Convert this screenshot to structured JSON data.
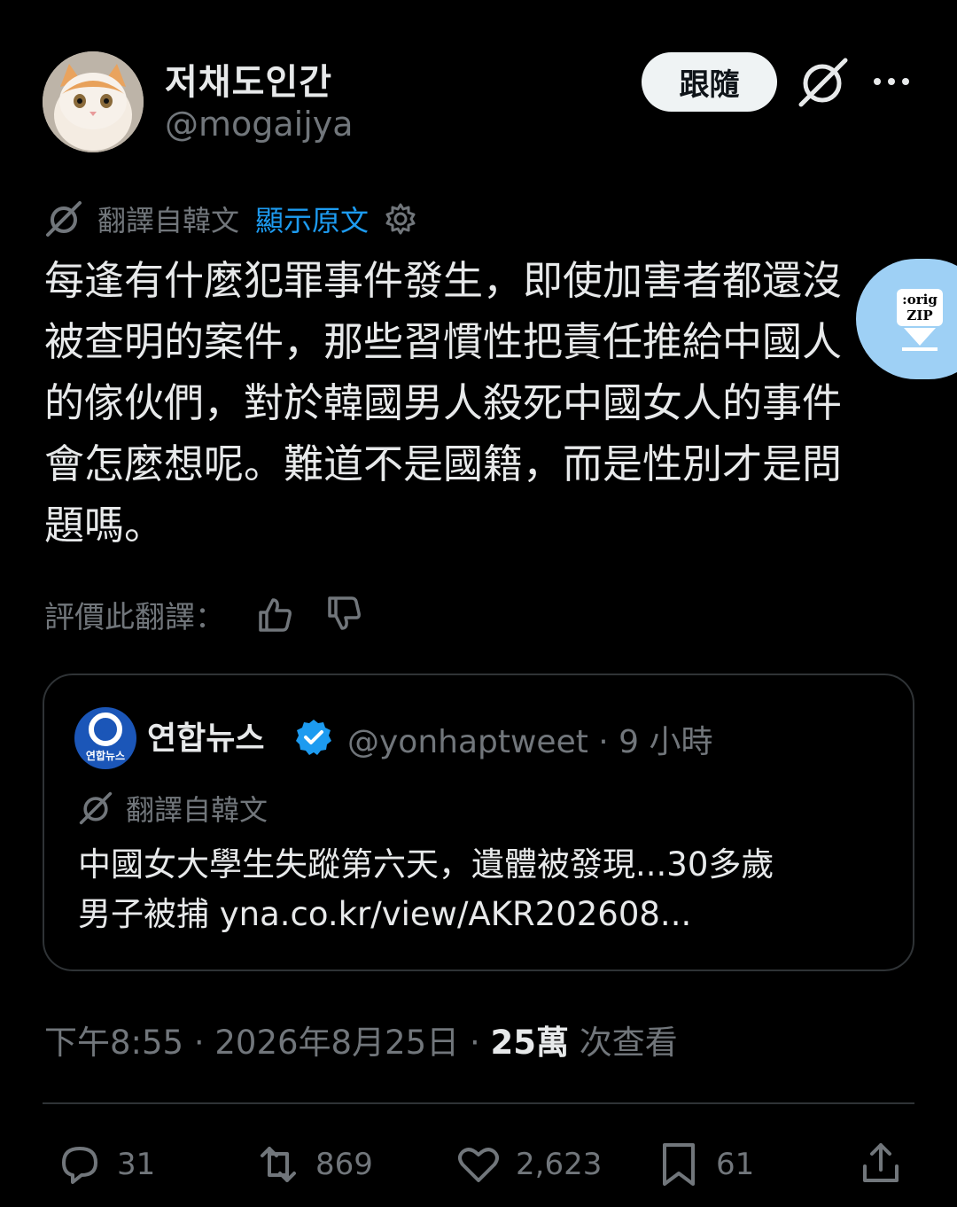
{
  "author": {
    "display_name": "저채도인간",
    "handle": "@mogaijya",
    "avatar": "orange-white-cat-photo"
  },
  "header_actions": {
    "follow_label": "跟隨",
    "grok_icon": "grok-icon",
    "more_icon": "more-icon"
  },
  "translation": {
    "translated_from": "翻譯自韓文",
    "show_original": "顯示原文",
    "settings_icon": "gear-icon"
  },
  "tweet": {
    "text": "每逢有什麼犯罪事件發生，即使加害者都還沒\n被查明的案件，那些習慣性把責任推給中國人\n的傢伙們，對於韓國男人殺死中國女人的事件\n會怎麼想呢。難道不是國籍，而是性別才是問\n題嗎。"
  },
  "overlay": {
    "badge_line1": ":orig",
    "badge_line2": "ZIP"
  },
  "rating": {
    "label": "評價此翻譯："
  },
  "quote": {
    "avatar_brand": "연합뉴스",
    "name": "연합뉴스",
    "handle_time": "@yonhaptweet · 9 小時",
    "translated_from": "翻譯自韓文",
    "text": "中國女大學生失蹤第六天，遺體被發現...30多歲\n男子被捕 yna.co.kr/view/AKR202608..."
  },
  "meta": {
    "time": "下午8:55",
    "date": "2026年8月25日",
    "views_count": "25萬",
    "views_label": "次查看"
  },
  "actions": {
    "replies": "31",
    "retweets": "869",
    "likes": "2,623",
    "bookmarks": "61"
  },
  "colors": {
    "background": "#000000",
    "text": "#e7e9ea",
    "secondary": "#71767b",
    "link": "#1d9bf0",
    "divider": "#2f3336",
    "overlay": "#9ed0f5"
  }
}
